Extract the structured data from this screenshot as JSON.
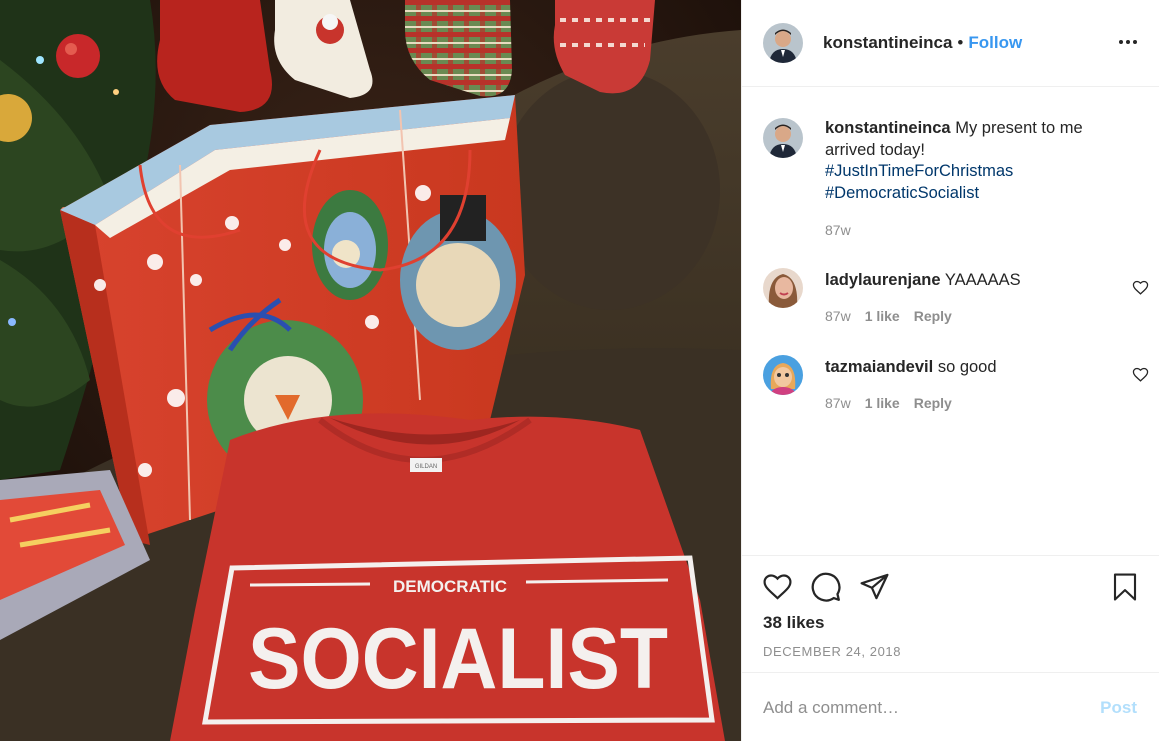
{
  "post": {
    "username": "konstantineinca",
    "follow_label": "Follow",
    "separator": "•",
    "more_icon": "more-horizontal-icon"
  },
  "photo": {
    "shirt_small_text": "DEMOCRATIC",
    "shirt_big_text": "SOCIALIST",
    "shirt_tag": "GILDAN"
  },
  "caption": {
    "username": "konstantineinca",
    "text": "My present to me arrived today!",
    "hashtags": [
      "#JustInTimeForChristmas",
      "#DemocraticSocialist"
    ],
    "time": "87w"
  },
  "comments": [
    {
      "username": "ladylaurenjane",
      "text": "YAAAAAS",
      "time": "87w",
      "likes": "1 like",
      "reply": "Reply"
    },
    {
      "username": "tazmaiandevil",
      "text": "so good",
      "time": "87w",
      "likes": "1 like",
      "reply": "Reply"
    }
  ],
  "actions": {
    "icons": [
      "heart-icon",
      "comment-icon",
      "share-icon",
      "bookmark-icon"
    ],
    "likes": "38 likes",
    "date": "DECEMBER 24, 2018"
  },
  "comment_box": {
    "placeholder": "Add a comment…",
    "post_label": "Post"
  },
  "colors": {
    "link_blue": "#3897f0",
    "hashtag": "#00376b",
    "muted": "#8e8e8e",
    "post_disabled": "#b2dffc",
    "shirt_red": "#c8342c"
  }
}
